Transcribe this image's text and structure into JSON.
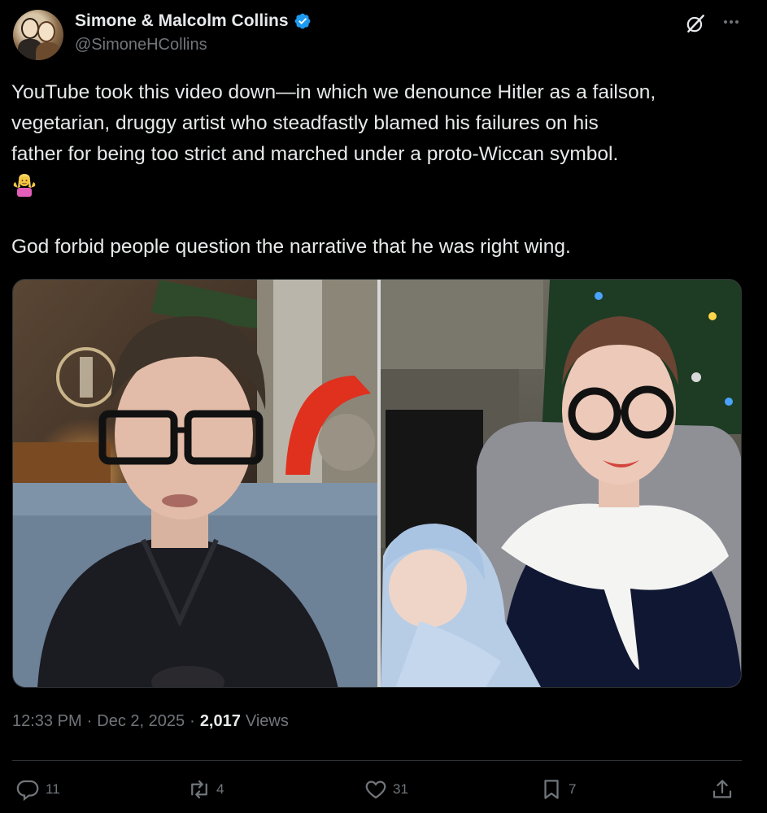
{
  "author": {
    "display_name": "Simone & Malcolm Collins",
    "handle": "@SimoneHCollins",
    "verified": true
  },
  "tweet": {
    "line1": "YouTube took this video down—in which we denounce Hitler as a failson,",
    "line2": "vegetarian, druggy artist who steadfastly blamed his failures on his",
    "line3": "father for being too strict and marched under a proto-Wiccan symbol.",
    "emoji": "person-shrugging",
    "line5": "God forbid people question the narrative that he was right wing."
  },
  "meta": {
    "time": "12:33 PM",
    "sep1": "·",
    "date": "Dec 2, 2025",
    "sep2": "·",
    "views_count": "2,017",
    "views_label": "Views"
  },
  "actions": {
    "replies": "11",
    "reposts": "4",
    "likes": "31",
    "bookmarks": "7"
  },
  "colors": {
    "background": "#000000",
    "text": "#e7e9ea",
    "muted": "#71767b",
    "verified": "#1d9bf0",
    "border": "#2f3336"
  },
  "icons": {
    "grok": "grok-icon",
    "more": "more-icon",
    "reply": "reply-icon",
    "repost": "repost-icon",
    "like": "heart-icon",
    "bookmark": "bookmark-icon",
    "share": "share-icon"
  }
}
